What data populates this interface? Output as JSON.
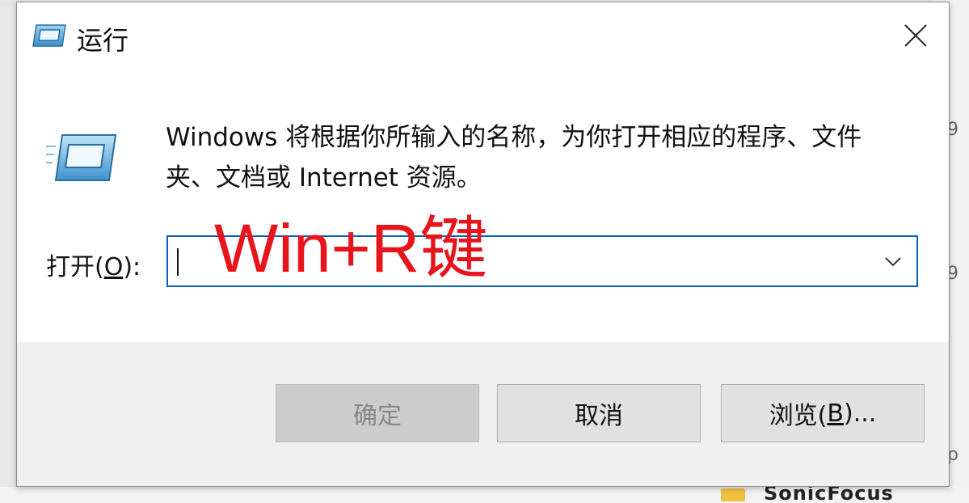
{
  "window": {
    "title": "运行",
    "icon": "run-icon",
    "close_icon": "close-icon"
  },
  "description": {
    "line1": "Windows 将根据你所输入的名称，为你打开相应的程序、文件",
    "line2": "夹、文档或 Internet 资源。"
  },
  "open_field": {
    "label_prefix": "打开(",
    "label_key": "O",
    "label_suffix": "):",
    "value": "",
    "dropdown_icon": "chevron-down-icon"
  },
  "annotation": {
    "text": "Win+R键",
    "color": "#e8141c"
  },
  "buttons": {
    "ok_label": "确定",
    "cancel_label": "取消",
    "browse_prefix": "浏览(",
    "browse_key": "B",
    "browse_suffix": ")..."
  },
  "background": {
    "right_chars": [
      "9",
      "9",
      "p"
    ],
    "bottom_text": "SonicFocus"
  },
  "colors": {
    "focus_border": "#0a5fb8",
    "annotation": "#e8141c",
    "footer": "#f0f0f0"
  }
}
